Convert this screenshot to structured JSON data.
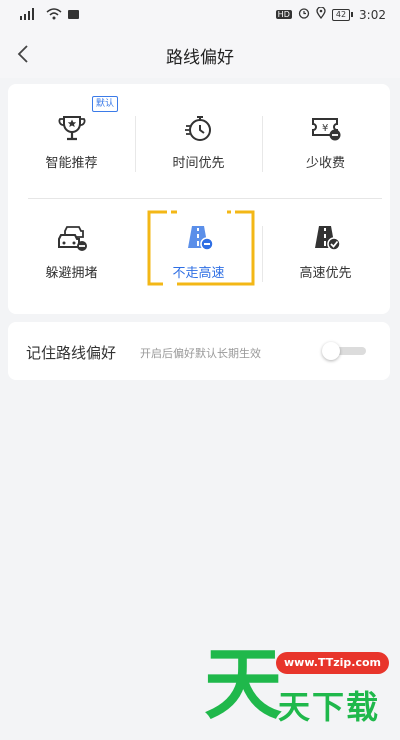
{
  "status_bar": {
    "signal": "⁴ᴳ",
    "hd": "HD",
    "battery": "42",
    "time": "3:02"
  },
  "navbar": {
    "title": "路线偏好"
  },
  "preferences": {
    "badge": "默认",
    "options": [
      {
        "label": "智能推荐",
        "icon": "trophy-icon",
        "selected": false
      },
      {
        "label": "时间优先",
        "icon": "stopwatch-icon",
        "selected": false
      },
      {
        "label": "少收费",
        "icon": "ticket-minus-icon",
        "selected": false
      },
      {
        "label": "躲避拥堵",
        "icon": "traffic-cars-icon",
        "selected": false
      },
      {
        "label": "不走高速",
        "icon": "highway-minus-icon",
        "selected": true
      },
      {
        "label": "高速优先",
        "icon": "highway-check-icon",
        "selected": false
      }
    ]
  },
  "remember": {
    "label": "记住路线偏好",
    "description": "开启后偏好默认长期生效",
    "enabled": false
  },
  "watermark": {
    "big_char": "天",
    "url": "www.TTzip.com",
    "sub": "天下载"
  },
  "colors": {
    "accent": "#2f6fe4",
    "selection_frame": "#f3b716",
    "watermark_green": "#1fb84b",
    "watermark_red": "#e8352b"
  }
}
